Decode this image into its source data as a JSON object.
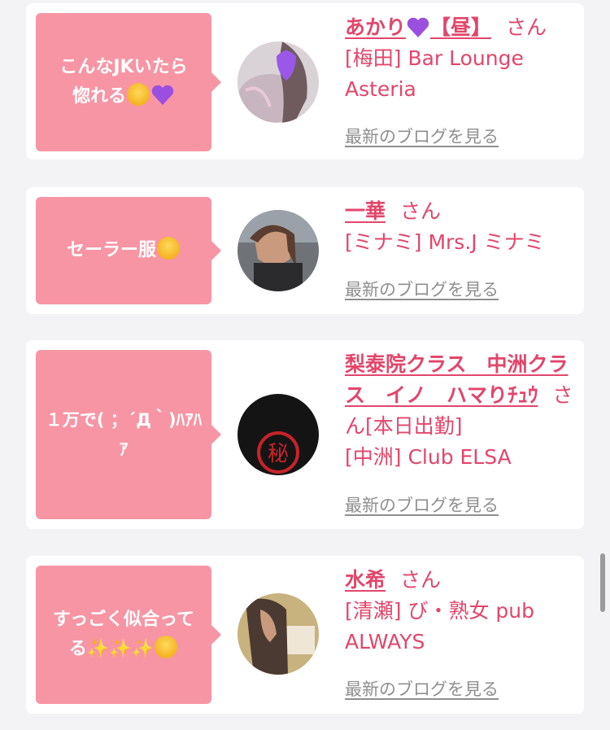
{
  "entries": [
    {
      "comment_text": "こんなJKいたら惚れる",
      "comment_emojis": [
        "pleading-face",
        "purple-heart"
      ],
      "name": "あかり",
      "name_suffix": "【昼】",
      "honorific": "さん",
      "status": "",
      "shop": "[梅田] Bar Lounge Asteria",
      "blog_link": "最新のブログを見る"
    },
    {
      "comment_text": "セーラー服",
      "comment_emojis": [
        "heart-eyes"
      ],
      "name": "一華",
      "name_suffix": "",
      "honorific": "さん",
      "status": "",
      "shop": "[ミナミ] Mrs.J ミナミ",
      "blog_link": "最新のブログを見る"
    },
    {
      "comment_text": "１万で( ；´Д｀)ﾊｱﾊｱ",
      "comment_emojis": [],
      "name": "梨泰院クラス　中洲クラス　イノ　ハマりﾁｭｳ",
      "name_suffix": "",
      "honorific": "さん",
      "status": "[本日出勤]",
      "shop": "[中洲] Club ELSA",
      "blog_link": "最新のブログを見る"
    },
    {
      "comment_text": "すっごく似合ってる✨✨✨",
      "comment_emojis": [
        "heart-eyes"
      ],
      "name": "水希",
      "name_suffix": "",
      "honorific": "さん",
      "status": "",
      "shop": "[清瀬] び・熟女 pub ALWAYS",
      "blog_link": "最新のブログを見る"
    }
  ],
  "colors": {
    "accent": "#e2466b",
    "bubble": "#f795a4",
    "link_gray": "#8f8f8f",
    "background": "#f3f3f5"
  }
}
